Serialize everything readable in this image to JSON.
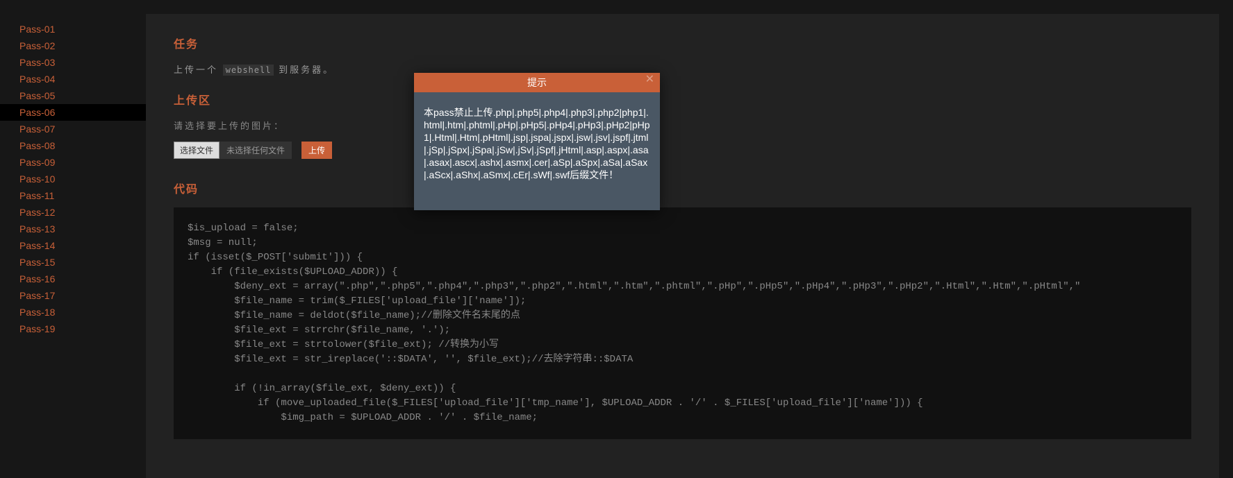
{
  "sidebar": {
    "items": [
      {
        "label": "Pass-01"
      },
      {
        "label": "Pass-02"
      },
      {
        "label": "Pass-03"
      },
      {
        "label": "Pass-04"
      },
      {
        "label": "Pass-05"
      },
      {
        "label": "Pass-06"
      },
      {
        "label": "Pass-07"
      },
      {
        "label": "Pass-08"
      },
      {
        "label": "Pass-09"
      },
      {
        "label": "Pass-10"
      },
      {
        "label": "Pass-11"
      },
      {
        "label": "Pass-12"
      },
      {
        "label": "Pass-13"
      },
      {
        "label": "Pass-14"
      },
      {
        "label": "Pass-15"
      },
      {
        "label": "Pass-16"
      },
      {
        "label": "Pass-17"
      },
      {
        "label": "Pass-18"
      },
      {
        "label": "Pass-19"
      }
    ],
    "active_index": 5
  },
  "sections": {
    "task_title": "任务",
    "task_desc_prefix": "上传一个",
    "task_desc_code": "webshell",
    "task_desc_suffix": "到服务器。",
    "upload_title": "上传区",
    "upload_label": "请选择要上传的图片：",
    "file_button": "选择文件",
    "file_placeholder": "未选择任何文件",
    "upload_button": "上传",
    "code_title": "代码"
  },
  "code": "$is_upload = false;\n$msg = null;\nif (isset($_POST['submit'])) {\n    if (file_exists($UPLOAD_ADDR)) {\n        $deny_ext = array(\".php\",\".php5\",\".php4\",\".php3\",\".php2\",\".html\",\".htm\",\".phtml\",\".pHp\",\".pHp5\",\".pHp4\",\".pHp3\",\".pHp2\",\".Html\",\".Htm\",\".pHtml\",\"\n        $file_name = trim($_FILES['upload_file']['name']);\n        $file_name = deldot($file_name);//删除文件名末尾的点\n        $file_ext = strrchr($file_name, '.');\n        $file_ext = strtolower($file_ext); //转换为小写\n        $file_ext = str_ireplace('::$DATA', '', $file_ext);//去除字符串::$DATA\n\n        if (!in_array($file_ext, $deny_ext)) {\n            if (move_uploaded_file($_FILES['upload_file']['tmp_name'], $UPLOAD_ADDR . '/' . $_FILES['upload_file']['name'])) {\n                $img_path = $UPLOAD_ADDR . '/' . $file_name;",
  "modal": {
    "title": "提示",
    "body": "本pass禁止上传.php|.php5|.php4|.php3|.php2|php1|.html|.htm|.phtml|.pHp|.pHp5|.pHp4|.pHp3|.pHp2|pHp1|.Html|.Htm|.pHtml|.jsp|.jspa|.jspx|.jsw|.jsv|.jspf|.jtml|.jSp|.jSpx|.jSpa|.jSw|.jSv|.jSpf|.jHtml|.asp|.aspx|.asa|.asax|.ascx|.ashx|.asmx|.cer|.aSp|.aSpx|.aSa|.aSax|.aScx|.aShx|.aSmx|.cEr|.sWf|.swf后缀文件！"
  }
}
